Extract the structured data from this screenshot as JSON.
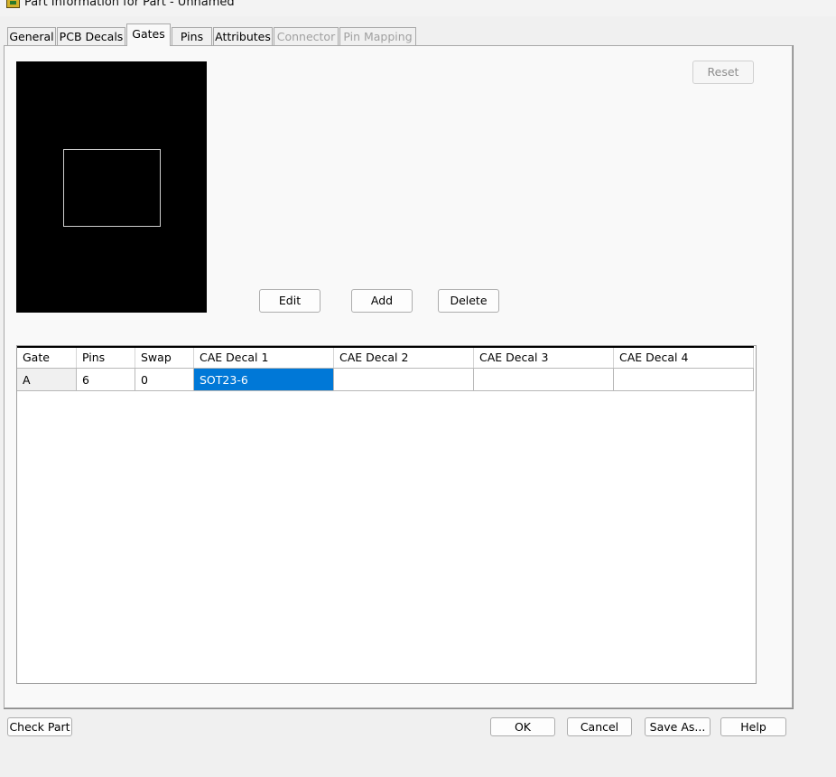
{
  "window": {
    "title": "Part Information for Part - Unnamed"
  },
  "tabs": [
    {
      "label": "General",
      "state": "normal"
    },
    {
      "label": "PCB Decals",
      "state": "normal"
    },
    {
      "label": "Gates",
      "state": "active"
    },
    {
      "label": "Pins",
      "state": "normal"
    },
    {
      "label": "Attributes",
      "state": "normal"
    },
    {
      "label": "Connector",
      "state": "disabled"
    },
    {
      "label": "Pin Mapping",
      "state": "disabled"
    }
  ],
  "gates_tab": {
    "reset_label": "Reset",
    "edit_label": "Edit",
    "add_label": "Add",
    "delete_label": "Delete",
    "grid": {
      "columns": [
        "Gate",
        "Pins",
        "Swap",
        "CAE Decal 1",
        "CAE Decal 2",
        "CAE Decal 3",
        "CAE Decal 4"
      ],
      "rows": [
        [
          "A",
          "6",
          "0",
          "SOT23-6",
          "",
          "",
          ""
        ]
      ],
      "selected_cell": "SOT23-6"
    }
  },
  "footer": {
    "check_part_label": "Check Part",
    "ok_label": "OK",
    "cancel_label": "Cancel",
    "save_as_label": "Save As...",
    "help_label": "Help"
  },
  "colors": {
    "selection": "#0078d7",
    "preview_bg": "#000000"
  }
}
